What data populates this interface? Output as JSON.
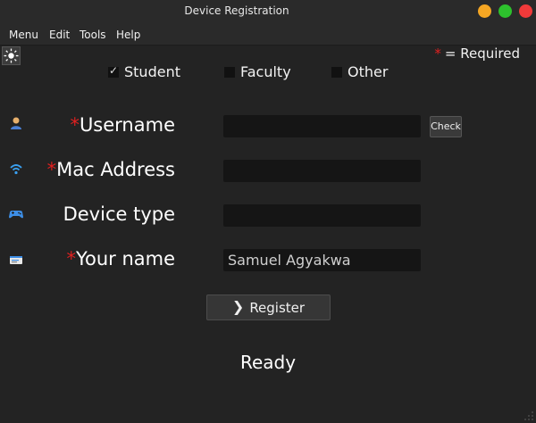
{
  "window": {
    "title": "Device Registration",
    "controls": {
      "minimize_color": "#f5a623",
      "maximize_color": "#2dc12d",
      "close_color": "#f03a3a"
    }
  },
  "menubar": {
    "items": [
      {
        "label": "Menu"
      },
      {
        "label": "Edit"
      },
      {
        "label": "Tools"
      },
      {
        "label": "Help"
      }
    ]
  },
  "toolbar": {
    "theme_toggle_icon": "sun-icon"
  },
  "required_note": {
    "star": "*",
    "text": "= Required"
  },
  "roles": [
    {
      "label": "Student",
      "checked": true
    },
    {
      "label": "Faculty",
      "checked": false
    },
    {
      "label": "Other",
      "checked": false
    }
  ],
  "form": {
    "username": {
      "star": "*",
      "label": "Username",
      "value": "",
      "icon": "user-icon"
    },
    "check_button": "Check",
    "mac_address": {
      "star": "*",
      "label": "Mac Address",
      "value": "",
      "icon": "wifi-icon"
    },
    "device_type": {
      "star": "",
      "label": "Device type",
      "value": "",
      "icon": "gamepad-icon"
    },
    "your_name": {
      "star": "*",
      "label": "Your name",
      "value": "Samuel Agyakwa",
      "icon": "id-card-icon"
    },
    "register_button": "Register",
    "register_icon": "chevron-right-icon"
  },
  "status": {
    "text": "Ready"
  },
  "colors": {
    "background": "#232323",
    "field_bg": "#151515",
    "required_star": "#e02020",
    "button_bg": "#363636"
  }
}
